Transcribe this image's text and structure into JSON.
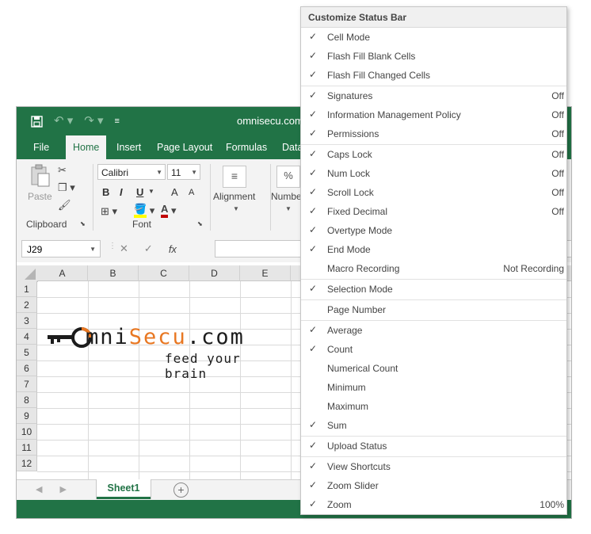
{
  "excel": {
    "doc_title": "omnisecu.com",
    "qat": {
      "save_icon": "save-icon",
      "undo_icon": "undo-icon",
      "redo_icon": "redo-icon"
    },
    "tabs": [
      "File",
      "Home",
      "Insert",
      "Page Layout",
      "Formulas",
      "Data"
    ],
    "active_tab": "Home",
    "ribbon": {
      "clipboard": {
        "paste_label": "Paste",
        "group_label": "Clipboard"
      },
      "font": {
        "font_name": "Calibri",
        "font_size": "11",
        "bold": "B",
        "italic": "I",
        "underline": "U",
        "grow": "A",
        "shrink": "A",
        "group_label": "Font"
      },
      "alignment": {
        "label": "Alignment"
      },
      "number": {
        "label": "Number",
        "percent": "%"
      }
    },
    "name_box": "J29",
    "fx": "fx",
    "columns": [
      "A",
      "B",
      "C",
      "D",
      "E"
    ],
    "rows": [
      "1",
      "2",
      "3",
      "4",
      "5",
      "6",
      "7",
      "8",
      "9",
      "10",
      "11",
      "12"
    ],
    "sheet_tab": "Sheet1",
    "add_sheet": "+",
    "logo": {
      "main_prefix": "mni",
      "main_orange": "Secu",
      "main_suffix": ".com",
      "tagline": "feed your brain"
    }
  },
  "menu": {
    "title": "Customize Status Bar",
    "items": [
      {
        "label": "Cell Mode",
        "checked": true,
        "value": ""
      },
      {
        "label": "Flash Fill Blank Cells",
        "checked": true,
        "value": ""
      },
      {
        "label": "Flash Fill Changed Cells",
        "checked": true,
        "value": ""
      },
      {
        "label": "Signatures",
        "checked": true,
        "value": "Off"
      },
      {
        "label": "Information Management Policy",
        "checked": true,
        "value": "Off"
      },
      {
        "label": "Permissions",
        "checked": true,
        "value": "Off"
      },
      {
        "label": "Caps Lock",
        "checked": true,
        "value": "Off"
      },
      {
        "label": "Num Lock",
        "checked": true,
        "value": "Off"
      },
      {
        "label": "Scroll Lock",
        "checked": true,
        "value": "Off"
      },
      {
        "label": "Fixed Decimal",
        "checked": true,
        "value": "Off"
      },
      {
        "label": "Overtype Mode",
        "checked": true,
        "value": ""
      },
      {
        "label": "End Mode",
        "checked": true,
        "value": ""
      },
      {
        "label": "Macro Recording",
        "checked": false,
        "value": "Not Recording"
      },
      {
        "label": "Selection Mode",
        "checked": true,
        "value": ""
      },
      {
        "label": "Page Number",
        "checked": false,
        "value": ""
      },
      {
        "label": "Average",
        "checked": true,
        "value": ""
      },
      {
        "label": "Count",
        "checked": true,
        "value": ""
      },
      {
        "label": "Numerical Count",
        "checked": false,
        "value": ""
      },
      {
        "label": "Minimum",
        "checked": false,
        "value": ""
      },
      {
        "label": "Maximum",
        "checked": false,
        "value": ""
      },
      {
        "label": "Sum",
        "checked": true,
        "value": ""
      },
      {
        "label": "Upload Status",
        "checked": true,
        "value": ""
      },
      {
        "label": "View Shortcuts",
        "checked": true,
        "value": ""
      },
      {
        "label": "Zoom Slider",
        "checked": true,
        "value": ""
      },
      {
        "label": "Zoom",
        "checked": true,
        "value": "100%"
      }
    ]
  },
  "colors": {
    "excel_green": "#217346",
    "logo_orange": "#e87722"
  }
}
